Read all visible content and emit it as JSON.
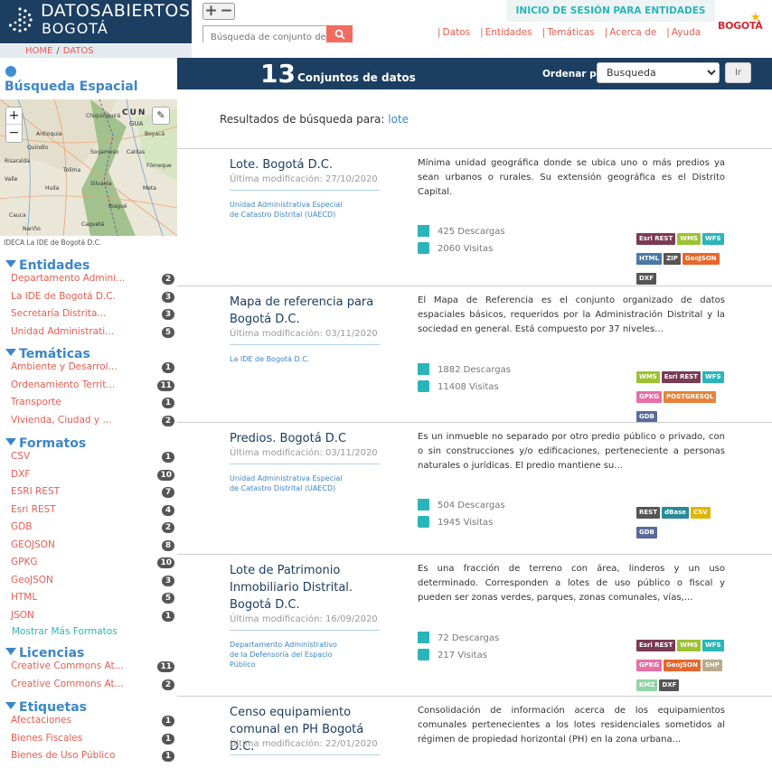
{
  "brand": {
    "line1": "DATOSABIERTOS",
    "line2": "BOGOTÁ",
    "city_logo": "BOGOTÁ"
  },
  "header": {
    "login_label": "INICIO DE SESIÓN PARA ENTIDADES",
    "zoom_in": "+",
    "zoom_out": "−",
    "search_placeholder": "Búsqueda de conjunto de",
    "nav": [
      "Datos",
      "Entidades",
      "Temáticas",
      "Acerca de",
      "Ayuda"
    ]
  },
  "breadcrumb": {
    "home": "HOME",
    "sep": "/",
    "current": "DATOS"
  },
  "spatial": {
    "title": "Búsqueda Espacial",
    "map_attribution": "IDECA La IDE de Bogotá D.C.",
    "zoom_in": "+",
    "zoom_out": "−",
    "map_labels": [
      "CUN",
      "GUA",
      "Caldas",
      "Antioquia",
      "Boyacá",
      "Tolima",
      "Meta",
      "Huila",
      "Quindío",
      "Cauca",
      "Caquetá",
      "Nariño",
      "Valle",
      "Risaralda",
      "Chiquinquirá",
      "Sogamoso",
      "Fómeque",
      "Silvania",
      "Ibagué"
    ]
  },
  "filters": [
    {
      "title": "Entidades",
      "items": [
        {
          "label": "Departamento Admini...",
          "count": "2"
        },
        {
          "label": "La IDE de Bogotá D.C.",
          "count": "3"
        },
        {
          "label": "Secretaría Distrita...",
          "count": "3"
        },
        {
          "label": "Unidad Administrati...",
          "count": "5"
        }
      ]
    },
    {
      "title": "Temáticas",
      "items": [
        {
          "label": "Ambiente y Desarrol...",
          "count": "1"
        },
        {
          "label": "Ordenamiento Territ...",
          "count": "11"
        },
        {
          "label": "Transporte",
          "count": "1"
        },
        {
          "label": "Vivienda, Ciudad y ...",
          "count": "2"
        }
      ]
    },
    {
      "title": "Formatos",
      "items": [
        {
          "label": "CSV",
          "count": "1"
        },
        {
          "label": "DXF",
          "count": "10"
        },
        {
          "label": "ESRI REST",
          "count": "7"
        },
        {
          "label": "Esri REST",
          "count": "4"
        },
        {
          "label": "GDB",
          "count": "2"
        },
        {
          "label": "GEOJSON",
          "count": "8"
        },
        {
          "label": "GPKG",
          "count": "10"
        },
        {
          "label": "GeoJSON",
          "count": "3"
        },
        {
          "label": "HTML",
          "count": "5"
        },
        {
          "label": "JSON",
          "count": "1"
        }
      ],
      "more": "Mostrar Más Formatos"
    },
    {
      "title": "Licencias",
      "items": [
        {
          "label": "Creative Commons At...",
          "count": "11"
        },
        {
          "label": "Creative Commons At...",
          "count": "2"
        }
      ]
    },
    {
      "title": "Etiquetas",
      "items": [
        {
          "label": "Afectaciones",
          "count": "1"
        },
        {
          "label": "Bienes Fiscales",
          "count": "1"
        },
        {
          "label": "Bienes de Uso Público",
          "count": "1"
        }
      ]
    }
  ],
  "results": {
    "count": "13",
    "count_label": "Conjuntos de datos",
    "sort_label": "Ordenar por",
    "sort_value": "Busqueda",
    "go_label": "Ir",
    "query_prefix": "Resultados de búsqueda para:",
    "query_term": "lote"
  },
  "datasets": [
    {
      "title": "Lote. Bogotá D.C.",
      "modified": "Última modificación: 27/10/2020",
      "org": "Unidad Administrativa Especial de Catastro Distrital (UAECD)",
      "description": "Mínima unidad geográfica donde se ubica uno o más predios ya sean urbanos o rurales. Su extensión geográfica es el Distrito Capital.",
      "downloads": "425 Descargas",
      "visits": "2060 Visitas",
      "tags": [
        {
          "label": "Esri REST",
          "color": "#7b3a53"
        },
        {
          "label": "WMS",
          "color": "#9cc22f"
        },
        {
          "label": "WFS",
          "color": "#2ab5ba"
        },
        {
          "label": "HTML",
          "color": "#4a78a8"
        },
        {
          "label": "ZIP",
          "color": "#555555"
        },
        {
          "label": "GeoJSON",
          "color": "#e8662a"
        },
        {
          "label": "DXF",
          "color": "#555555"
        }
      ]
    },
    {
      "title": "Mapa de referencia para Bogotá D.C.",
      "modified": "Última modificación: 03/11/2020",
      "org": "La IDE de Bogotá D.C.",
      "description": "El Mapa de Referencia es el conjunto organizado de datos espaciales básicos, requeridos por la Administración Distrital y la sociedad en general. Está compuesto por 37 niveles...",
      "downloads": "1882 Descargas",
      "visits": "11408 Visitas",
      "tags": [
        {
          "label": "WMS",
          "color": "#9cc22f"
        },
        {
          "label": "Esri REST",
          "color": "#7b3a53"
        },
        {
          "label": "WFS",
          "color": "#2ab5ba"
        },
        {
          "label": "GPKG",
          "color": "#e86ea5"
        },
        {
          "label": "POSTGRESQL",
          "color": "#e8823a"
        },
        {
          "label": "GDB",
          "color": "#5a6a9a"
        }
      ]
    },
    {
      "title": "Predios. Bogotá D.C",
      "modified": "Última modificación: 03/11/2020",
      "org": "Unidad Administrativa Especial de Catastro Distrital (UAECD)",
      "description": "Es un inmueble no separado por otro predio público o privado, con o sin construcciones y/o edificaciones, perteneciente a personas naturales o jurídicas. El predio mantiene su...",
      "downloads": "504 Descargas",
      "visits": "1945 Visitas",
      "tags": [
        {
          "label": "REST",
          "color": "#555555"
        },
        {
          "label": "dBase",
          "color": "#2a8a9a"
        },
        {
          "label": "CSV",
          "color": "#e0b400"
        },
        {
          "label": "GDB",
          "color": "#5a6a9a"
        }
      ]
    },
    {
      "title": "Lote de Patrimonio Inmobiliario Distrital. Bogotá D.C.",
      "modified": "Última modificación: 16/09/2020",
      "org": "Departamento Administrativo de la Defensoría del Espacio Público",
      "description": "Es una fracción de terreno con área, linderos y un uso determinado. Corresponden a lotes de uso público o fiscal y pueden ser zonas verdes, parques, zonas comunales, vías,...",
      "downloads": "72 Descargas",
      "visits": "217 Visitas",
      "tags": [
        {
          "label": "Esri REST",
          "color": "#7b3a53"
        },
        {
          "label": "WMS",
          "color": "#9cc22f"
        },
        {
          "label": "WFS",
          "color": "#2ab5ba"
        },
        {
          "label": "GPKG",
          "color": "#e86ea5"
        },
        {
          "label": "GeoJSON",
          "color": "#e8662a"
        },
        {
          "label": "SHP",
          "color": "#b8aa8a"
        },
        {
          "label": "KMZ",
          "color": "#8fd4a8"
        },
        {
          "label": "DXF",
          "color": "#555555"
        }
      ]
    },
    {
      "title": "Censo equipamiento comunal en PH Bogotá D.C.",
      "modified": "Última modificación: 22/01/2020",
      "org": "",
      "description": "Consolidación de información acerca de los equipamientos comunales pertenecientes a los lotes residenciales sometidos al régimen de propiedad horizontal (PH) en la zona urbana...",
      "downloads": "",
      "visits": "",
      "tags": []
    }
  ],
  "colors": {
    "navy": "#1b3e61",
    "accent_red": "#e85d50",
    "accent_blue": "#3b86c8",
    "teal": "#2ab5ba"
  }
}
